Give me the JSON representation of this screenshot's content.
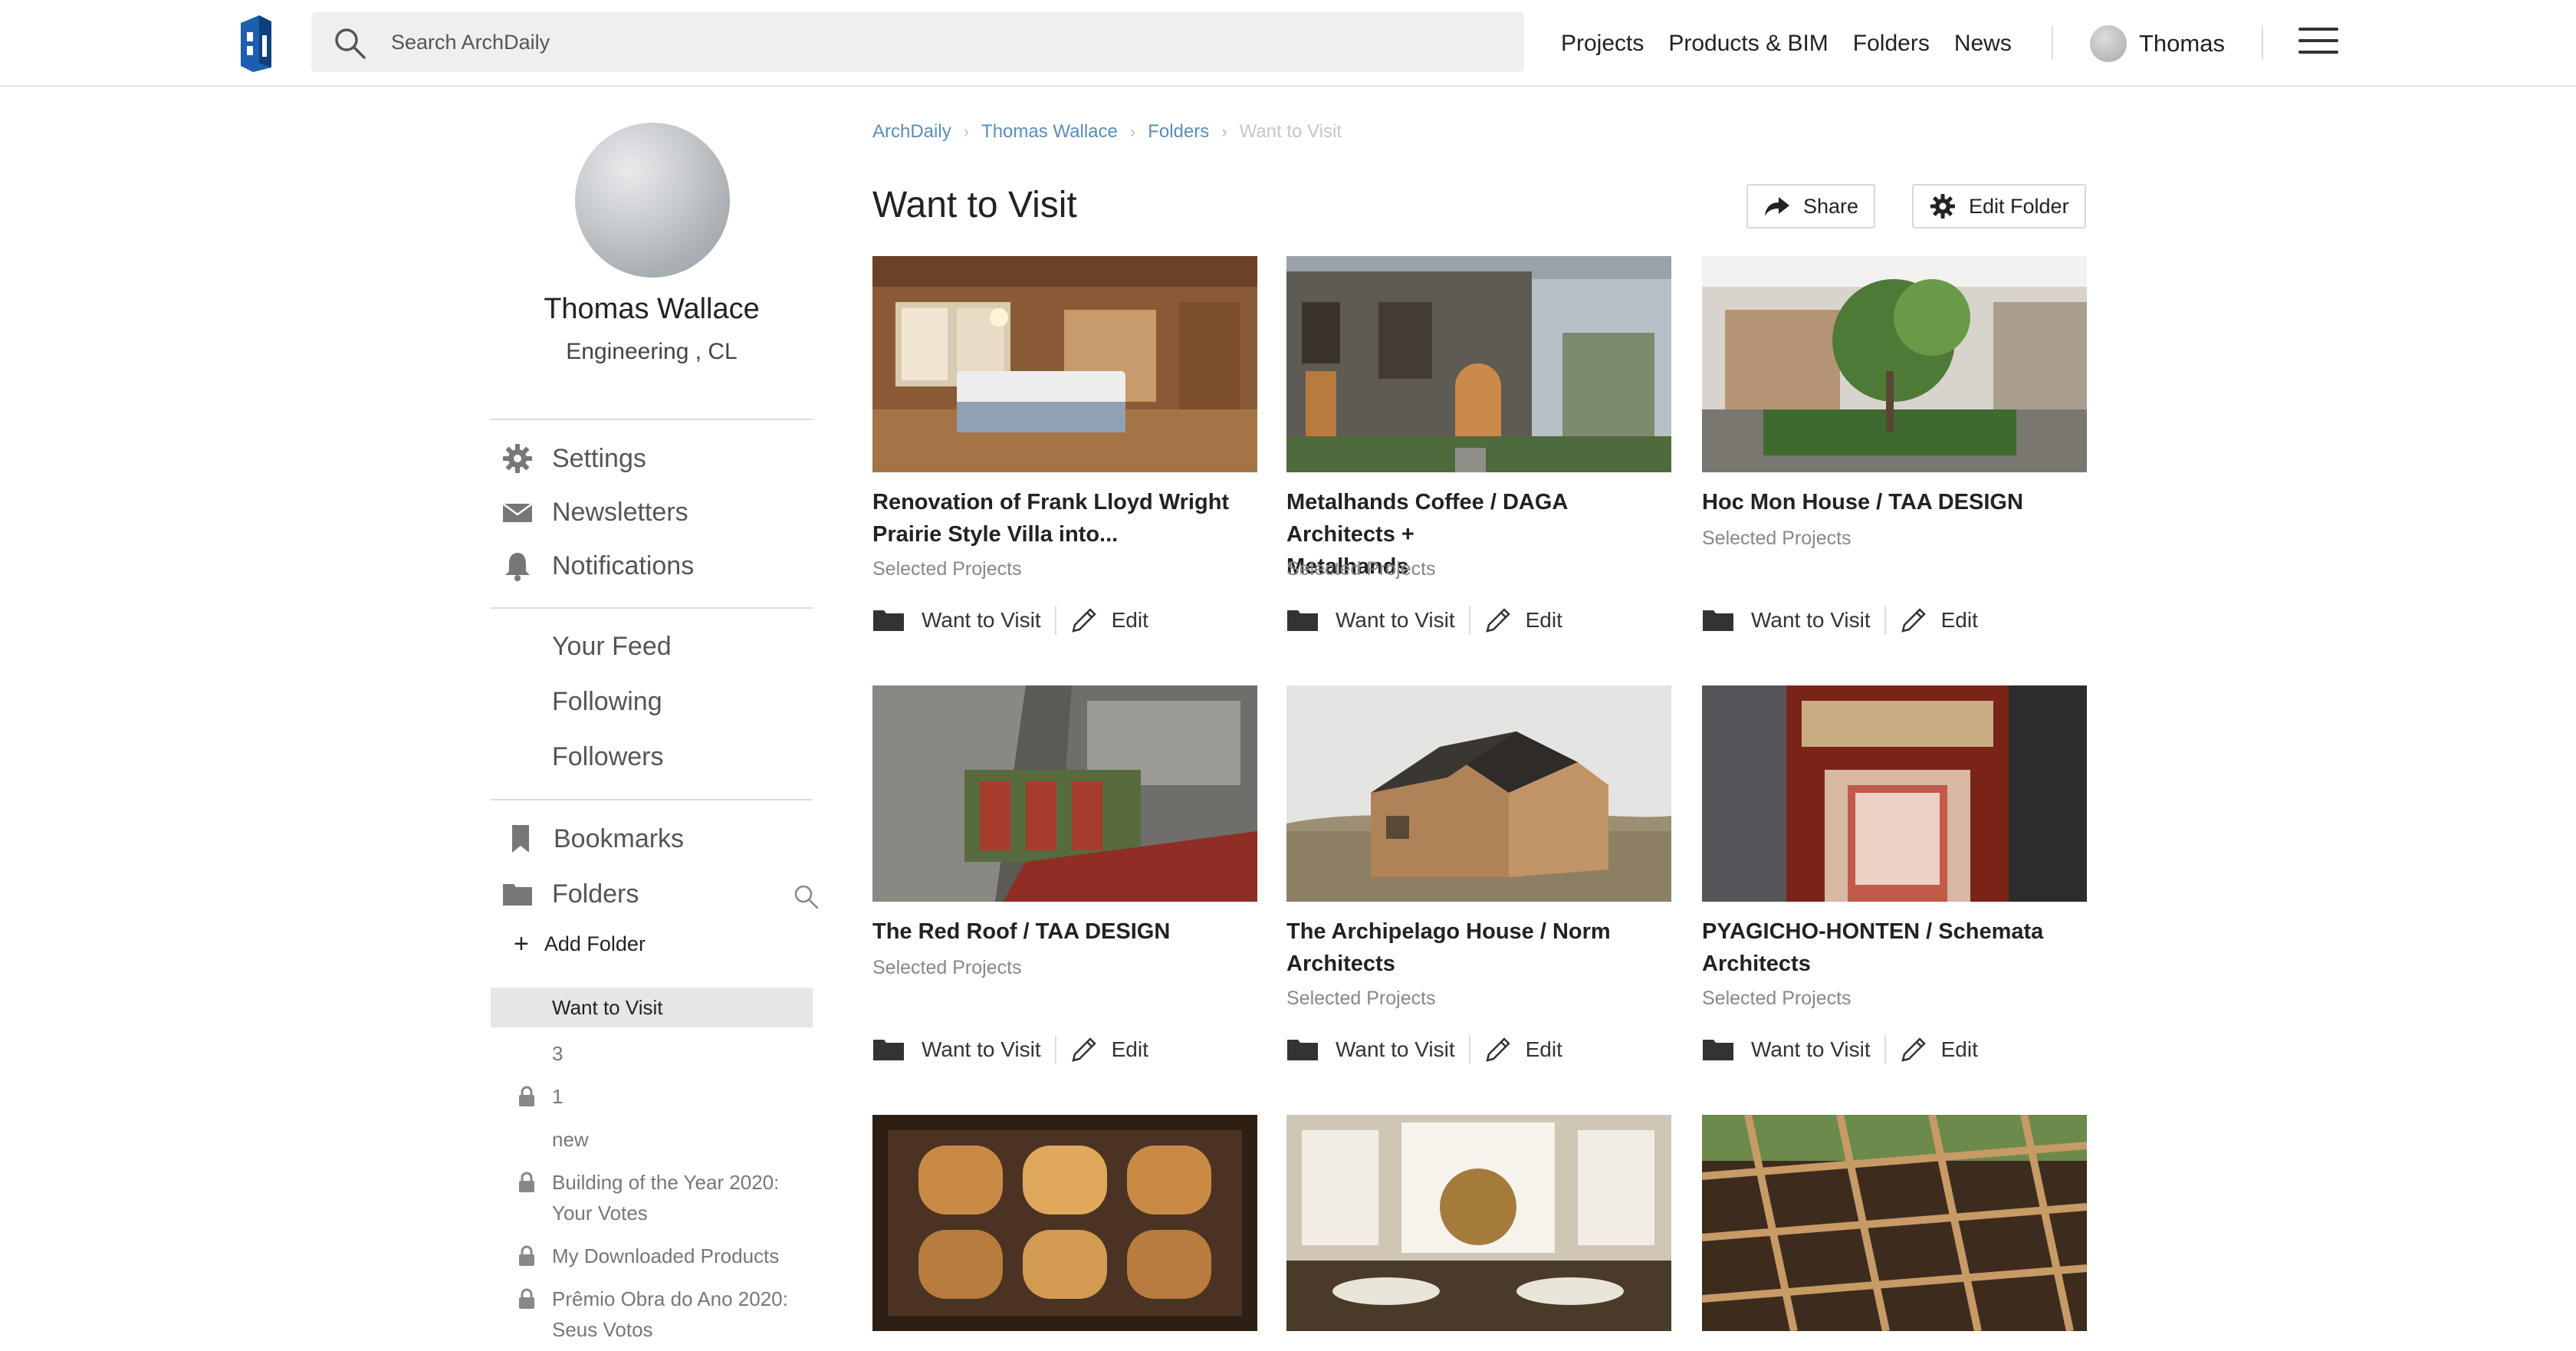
{
  "header": {
    "search_placeholder": "Search ArchDaily",
    "nav": [
      "Projects",
      "Products & BIM",
      "Folders",
      "News"
    ],
    "user_name": "Thomas"
  },
  "profile": {
    "name": "Thomas Wallace",
    "role": "Engineering , CL"
  },
  "sidebar": {
    "account": [
      {
        "label": "Settings",
        "icon": "gear-icon"
      },
      {
        "label": "Newsletters",
        "icon": "envelope-icon"
      },
      {
        "label": "Notifications",
        "icon": "bell-icon"
      }
    ],
    "social": [
      "Your Feed",
      "Following",
      "Followers"
    ],
    "bookmarks_label": "Bookmarks",
    "folders_label": "Folders",
    "add_folder_label": "Add Folder",
    "folders": [
      {
        "name": "Want to Visit",
        "locked": false,
        "active": true
      },
      {
        "name": "3",
        "locked": false
      },
      {
        "name": "1",
        "locked": true
      },
      {
        "name": "new",
        "locked": false
      },
      {
        "name": "Building of the Year 2020:",
        "name2": "Your Votes",
        "locked": true
      },
      {
        "name": "My Downloaded Products",
        "locked": true
      },
      {
        "name": "Prêmio Obra do Ano 2020:",
        "name2": "Seus Votos",
        "locked": true
      }
    ]
  },
  "breadcrumb": [
    "ArchDaily",
    "Thomas Wallace",
    "Folders",
    "Want to Visit"
  ],
  "folder": {
    "title": "Want to Visit",
    "share_label": "Share",
    "edit_folder_label": "Edit Folder"
  },
  "cards": [
    {
      "title_line1": "Renovation of Frank Lloyd Wright",
      "title_line2": "Prairie Style Villa into...",
      "category": "Selected Projects",
      "folder": "Want to Visit",
      "edit": "Edit"
    },
    {
      "title_line1": "Metalhands Coffee / DAGA Architects +",
      "title_line2": "Metalhands",
      "category": "Selected Projects",
      "folder": "Want to Visit",
      "edit": "Edit"
    },
    {
      "title_line1": "Hoc Mon House / TAA DESIGN",
      "title_line2": "",
      "category": "Selected Projects",
      "folder": "Want to Visit",
      "edit": "Edit"
    },
    {
      "title_line1": "The Red Roof / TAA DESIGN",
      "title_line2": "",
      "category": "Selected Projects",
      "folder": "Want to Visit",
      "edit": "Edit"
    },
    {
      "title_line1": "The Archipelago House / Norm",
      "title_line2": "Architects",
      "category": "Selected Projects",
      "folder": "Want to Visit",
      "edit": "Edit"
    },
    {
      "title_line1": "PYAGICHO-HONTEN / Schemata",
      "title_line2": "Architects",
      "category": "Selected Projects",
      "folder": "Want to Visit",
      "edit": "Edit"
    }
  ],
  "colors": {
    "link": "#5b8db8",
    "active_folder_bg": "#e6e6e6",
    "search_bg": "#efefef"
  }
}
